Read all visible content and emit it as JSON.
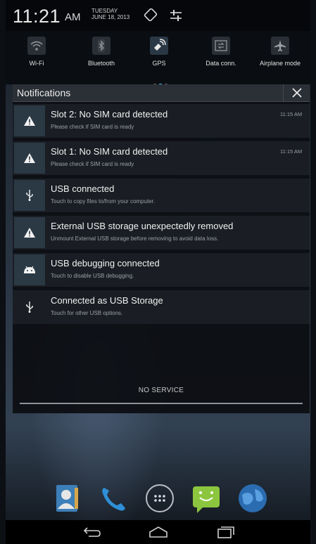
{
  "status": {
    "time": "11:21",
    "ampm": "AM",
    "day": "TUESDAY",
    "date": "JUNE 18, 2013",
    "rotate_icon": "auto-rotate-icon",
    "settings_icon": "settings-sliders-icon"
  },
  "quick_settings": [
    {
      "label": "Wi-Fi",
      "icon": "wifi-icon",
      "active": false
    },
    {
      "label": "Bluetooth",
      "icon": "bluetooth-icon",
      "active": false
    },
    {
      "label": "GPS",
      "icon": "gps-icon",
      "active": true
    },
    {
      "label": "Data conn.",
      "icon": "data-connection-icon",
      "active": false
    },
    {
      "label": "Airplane mode",
      "icon": "airplane-icon",
      "active": false
    }
  ],
  "notifications_header": {
    "title": "Notifications",
    "close_icon": "close-icon"
  },
  "notifications": [
    {
      "title": "Slot 2: No SIM card detected",
      "subtitle": "Please check if SIM card is ready",
      "time": "11:15 AM",
      "icon": "warning-icon"
    },
    {
      "title": "Slot 1: No SIM card detected",
      "subtitle": "Please check if SIM card is ready",
      "time": "11:15 AM",
      "icon": "warning-icon"
    },
    {
      "title": "USB connected",
      "subtitle": "Touch to copy files to/from your computer.",
      "time": "",
      "icon": "usb-icon"
    },
    {
      "title": "External USB storage unexpectedly removed",
      "subtitle": "Unmount External USB storage before removing to avoid data loss.",
      "time": "",
      "icon": "warning-icon"
    },
    {
      "title": "USB debugging connected",
      "subtitle": "Touch to disable USB debugging.",
      "time": "",
      "icon": "android-debug-icon"
    },
    {
      "title": "Connected as USB Storage",
      "subtitle": "Touch for other USB options.",
      "time": "",
      "icon": "usb-icon"
    }
  ],
  "footer": {
    "no_service": "NO SERVICE"
  },
  "dock": [
    "contacts-app-icon",
    "phone-app-icon",
    "app-drawer-icon",
    "messaging-app-icon",
    "browser-app-icon"
  ],
  "nav": [
    "back-icon",
    "home-icon",
    "recent-apps-icon"
  ],
  "colors": {
    "accent": "#33b5e5"
  }
}
